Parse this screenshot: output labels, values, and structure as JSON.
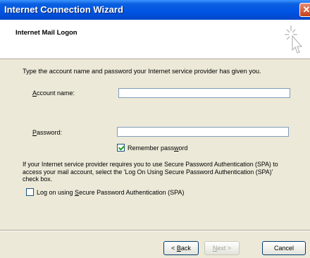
{
  "window": {
    "title": "Internet Connection Wizard",
    "close_symbol": "✕"
  },
  "header": {
    "title": "Internet Mail Logon",
    "icon": "wizard-sparkle-cursor"
  },
  "intro": "Type the account name and password your Internet service provider has given you.",
  "account": {
    "label_pre": "",
    "label_key": "A",
    "label_post": "ccount name:",
    "value": "",
    "placeholder": ""
  },
  "password": {
    "label_pre": "",
    "label_key": "P",
    "label_post": "assword:",
    "value": ""
  },
  "remember": {
    "label_pre": "Remember pass",
    "label_key": "w",
    "label_post": "ord",
    "checked": true
  },
  "spa": {
    "help": "If your Internet service provider requires you to use Secure Password Authentication (SPA) to access your mail account, select the 'Log On Using Secure Password Authentication (SPA)' check box.",
    "label_pre": "Log on using ",
    "label_key": "S",
    "label_post": "ecure Password Authentication (SPA)",
    "checked": false
  },
  "buttons": {
    "back_pre": "< ",
    "back_key": "B",
    "back_post": "ack",
    "next_pre": "",
    "next_key": "N",
    "next_post": "ext >",
    "cancel": "Cancel"
  }
}
